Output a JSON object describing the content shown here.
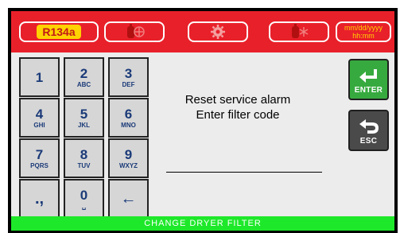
{
  "header": {
    "refrigerant": "R134a",
    "datetime": {
      "date": "mm/dd/yyyy",
      "time": "hh:mm"
    },
    "icons": [
      "tank-fan-icon",
      "gear-icon",
      "tank-snowflake-icon"
    ]
  },
  "keypad": {
    "keys": [
      {
        "digit": "1",
        "letters": ""
      },
      {
        "digit": "2",
        "letters": "ABC"
      },
      {
        "digit": "3",
        "letters": "DEF"
      },
      {
        "digit": "4",
        "letters": "GHI"
      },
      {
        "digit": "5",
        "letters": "JKL"
      },
      {
        "digit": "6",
        "letters": "MNO"
      },
      {
        "digit": "7",
        "letters": "PQRS"
      },
      {
        "digit": "8",
        "letters": "TUV"
      },
      {
        "digit": "9",
        "letters": "WXYZ"
      },
      {
        "symbol": ".,"
      },
      {
        "digit": "0",
        "letters": "␣"
      },
      {
        "symbol": "←"
      }
    ]
  },
  "message": {
    "line1": "Reset service alarm",
    "line2": "Enter filter code"
  },
  "buttons": {
    "enter_label": "ENTER",
    "esc_label": "ESC"
  },
  "status": "CHANGE DRYER FILTER",
  "colors": {
    "header_red": "#e8202a",
    "refrigerant_yellow": "#ffd200",
    "enter_green": "#37aa3f",
    "status_green": "#1ee82a",
    "key_text_blue": "#1a3a78"
  }
}
